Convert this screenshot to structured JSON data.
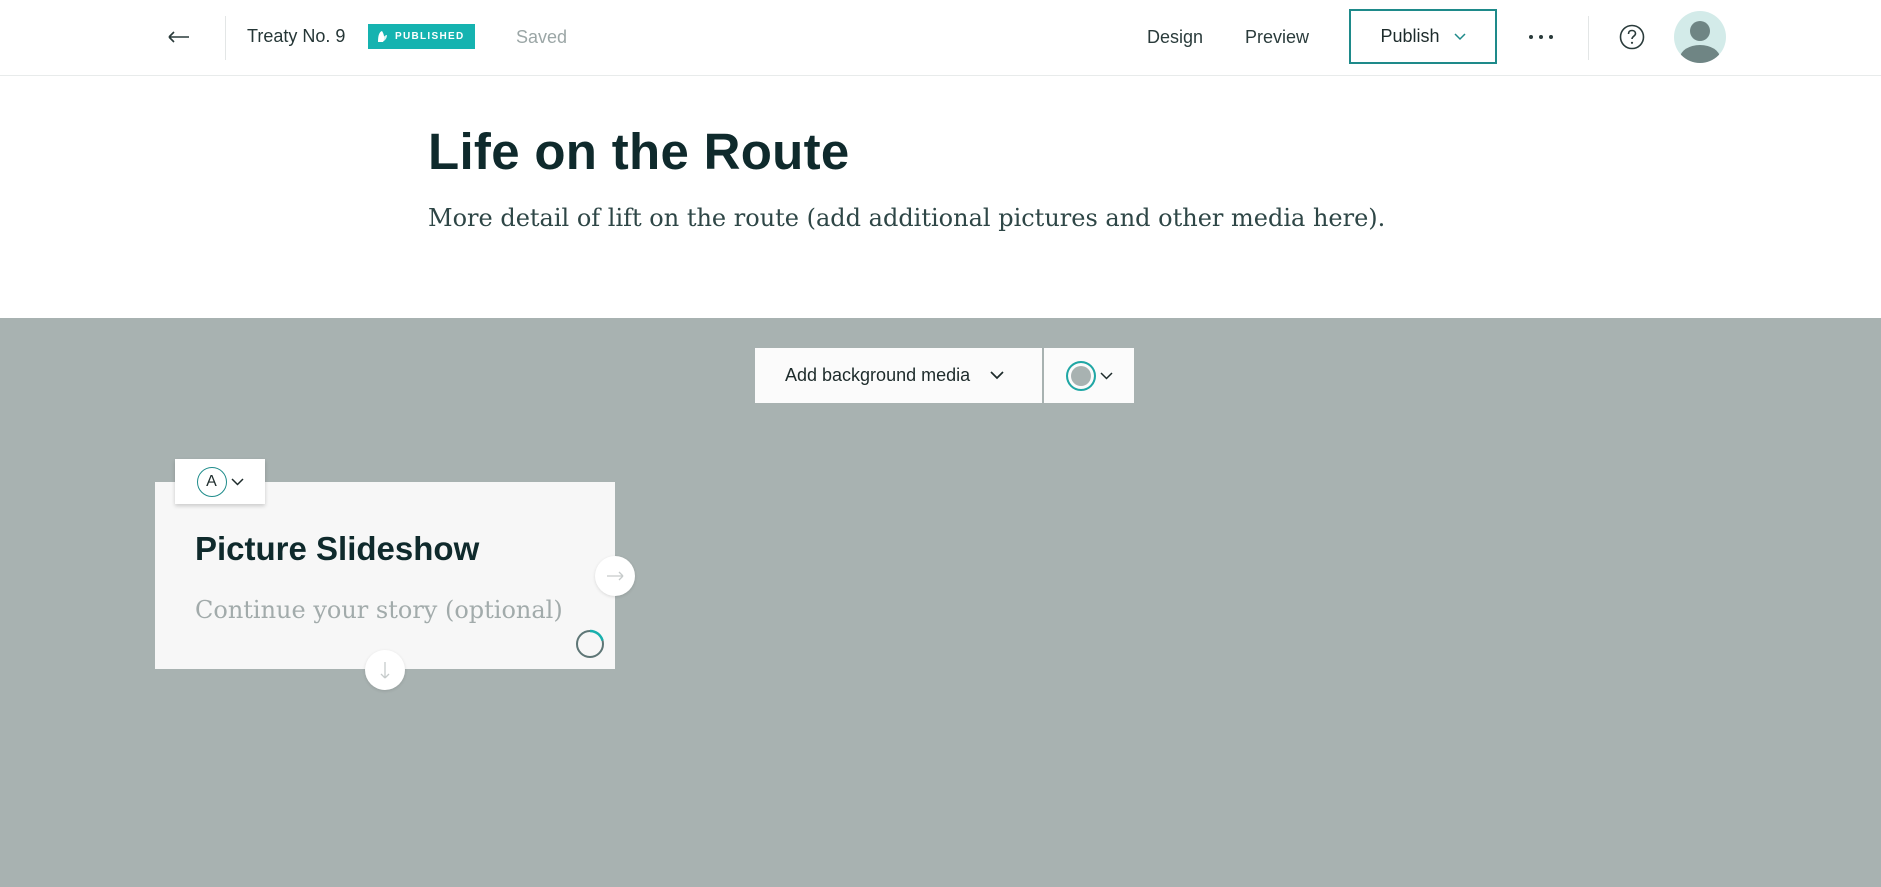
{
  "header": {
    "back_icon": "arrow-left-icon",
    "story_title": "Treaty No. 9",
    "badge_label": "PUBLISHED",
    "badge_icon": "leaf-icon",
    "badge_color": "#15b3b0",
    "save_status": "Saved",
    "nav": {
      "design": "Design",
      "preview": "Preview"
    },
    "publish_label": "Publish",
    "more_icon": "more-horizontal-icon",
    "help_icon": "help-circle-icon",
    "avatar_icon": "user-avatar-icon"
  },
  "section": {
    "title": "Life on the Route",
    "description": "More detail of lift on the route (add additional pictures and other media here)."
  },
  "toolbar": {
    "background_media_label": "Add background media",
    "color_swatch_color": "#a8b2b1"
  },
  "card": {
    "theme_letter": "A",
    "title": "Picture Slideshow",
    "body_placeholder": "Continue your story (optional)",
    "right_arrow_icon": "arrow-right-icon",
    "down_arrow_icon": "arrow-down-icon",
    "loading_icon": "spinner-icon"
  },
  "colors": {
    "accent": "#1e8a8a",
    "section_background": "#a8b2b1",
    "card_background": "#f7f7f7"
  }
}
